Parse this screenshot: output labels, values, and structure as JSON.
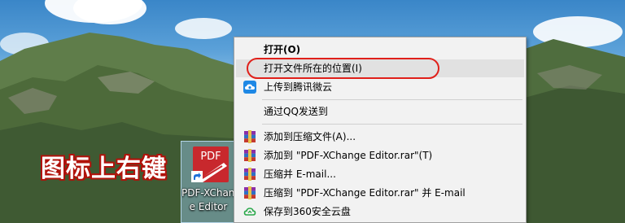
{
  "annotation": {
    "text": "图标上右键"
  },
  "desktop_icon": {
    "name_line1": "PDF-XChange",
    "name_line2": "e Editor",
    "glyph_text": "PDF",
    "icon": "pdf-xchange-app-icon",
    "colors": {
      "accent": "#c8282d"
    }
  },
  "context_menu": {
    "items": [
      {
        "label": "打开(O)",
        "icon": ""
      },
      {
        "label": "打开文件所在的位置(I)",
        "icon": ""
      },
      {
        "label": "上传到腾讯微云",
        "icon": "weiyun-cloud-icon"
      },
      {
        "label": "通过QQ发送到",
        "icon": ""
      },
      {
        "label": "添加到压缩文件(A)...",
        "icon": "winrar-icon"
      },
      {
        "label": "添加到 \"PDF-XChange Editor.rar\"(T)",
        "icon": "winrar-icon"
      },
      {
        "label": "压缩并 E-mail...",
        "icon": "winrar-icon"
      },
      {
        "label": "压缩到 \"PDF-XChange Editor.rar\" 并 E-mail",
        "icon": "winrar-icon"
      },
      {
        "label": "保存到360安全云盘",
        "icon": "360-cloud-icon"
      }
    ]
  },
  "colors": {
    "highlight_ring": "#e0201a",
    "menu_bg": "#f2f2f2",
    "hover_bg": "#e1e1e1"
  }
}
